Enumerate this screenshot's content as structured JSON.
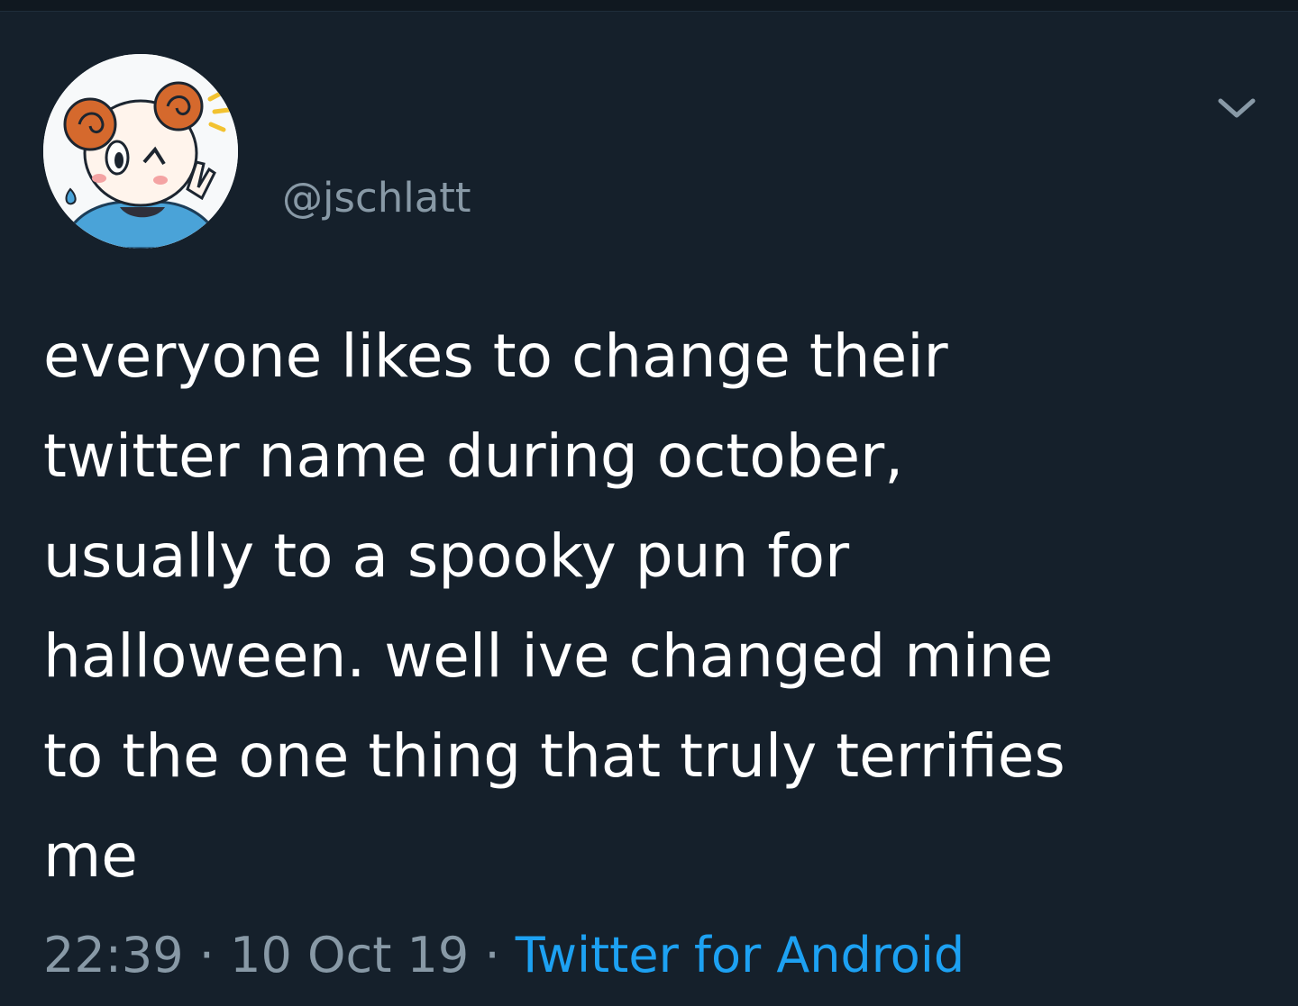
{
  "tweet": {
    "handle": "@jschlatt",
    "text": "everyone likes to change their\ntwitter name during october,\nusually to a spooky pun for\nhalloween. well ive changed mine\nto the one thing that truly terrifies\nme",
    "time": "22:39",
    "separator": "·",
    "date": "10 Oct 19",
    "source": "Twitter for Android"
  },
  "icons": {
    "avatar": "cartoon-ram-avatar",
    "menu": "chevron-down-icon"
  },
  "colors": {
    "background": "#15202b",
    "text": "#ffffff",
    "secondary": "#8899a6",
    "link": "#1da1f2"
  }
}
